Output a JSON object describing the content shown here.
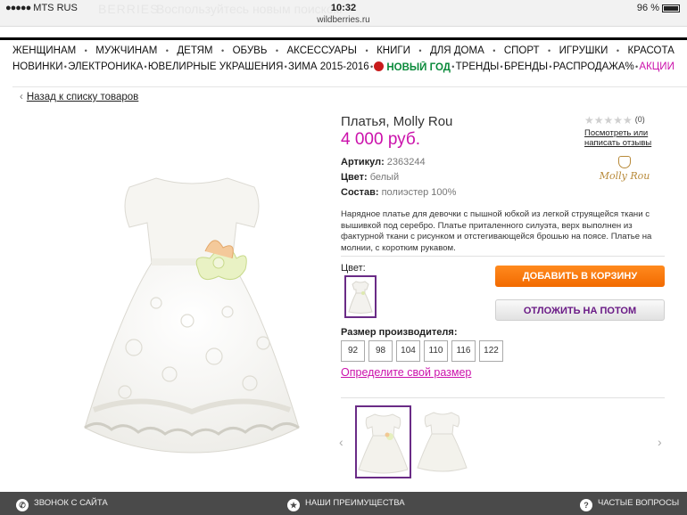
{
  "status": {
    "carrier": "MTS RUS",
    "time": "10:32",
    "url": "wildberries.ru",
    "battery": "96 %",
    "ghost_brand": "BERRIES",
    "ghost_text": "Воспользуйтесь новым поиском"
  },
  "nav": {
    "row1": [
      "ЖЕНЩИНАМ",
      "МУЖЧИНАМ",
      "ДЕТЯМ",
      "ОБУВЬ",
      "АКСЕССУАРЫ",
      "КНИГИ",
      "ДЛЯ ДОМА",
      "СПОРТ",
      "ИГРУШКИ",
      "КРАСОТА"
    ],
    "row2": [
      "НОВИНКИ",
      "ЭЛЕКТРОНИКА",
      "ЮВЕЛИРНЫЕ УКРАШЕНИЯ",
      "ЗИМА 2015-2016",
      "НОВЫЙ ГОД",
      "ТРЕНДЫ",
      "БРЕНДЫ",
      "РАСПРОДАЖА%",
      "АКЦИИ"
    ]
  },
  "back_link": "Назад к списку товаров",
  "product": {
    "title": "Платья, Molly Rou",
    "price": "4 000 руб.",
    "article_label": "Артикул:",
    "article_value": "2363244",
    "color_label": "Цвет:",
    "color_value": "белый",
    "composition_label": "Состав:",
    "composition_value": "полиэстер 100%",
    "description": "Нарядное платье для девочки с пышной юбкой из легкой струящейся ткани с вышивкой под серебро. Платье приталенного силуэта, верх выполнен из фактурной ткани с рисунком и отстегивающейся брошью на поясе. Платье на молнии, с коротким рукавом.",
    "color_section_label": "Цвет:",
    "size_label": "Размер производителя:",
    "sizes": [
      "92",
      "98",
      "104",
      "110",
      "116",
      "122"
    ],
    "size_link": "Определите свой размер"
  },
  "rating": {
    "stars": 0,
    "count": "(0)",
    "review_link": "Посмотреть или написать отзывы"
  },
  "brand_logo": "Molly Rou",
  "buttons": {
    "add_to_cart": "Добавить в корзину",
    "save_later": "Отложить на потом"
  },
  "bottom_bar": {
    "call": "Звонок с сайта",
    "advantages": "Наши преимущества",
    "faq": "Частые вопросы"
  },
  "colors": {
    "accent": "#cb11ab",
    "cart_button": "#f26a00",
    "selected_border": "#6a2b86"
  }
}
